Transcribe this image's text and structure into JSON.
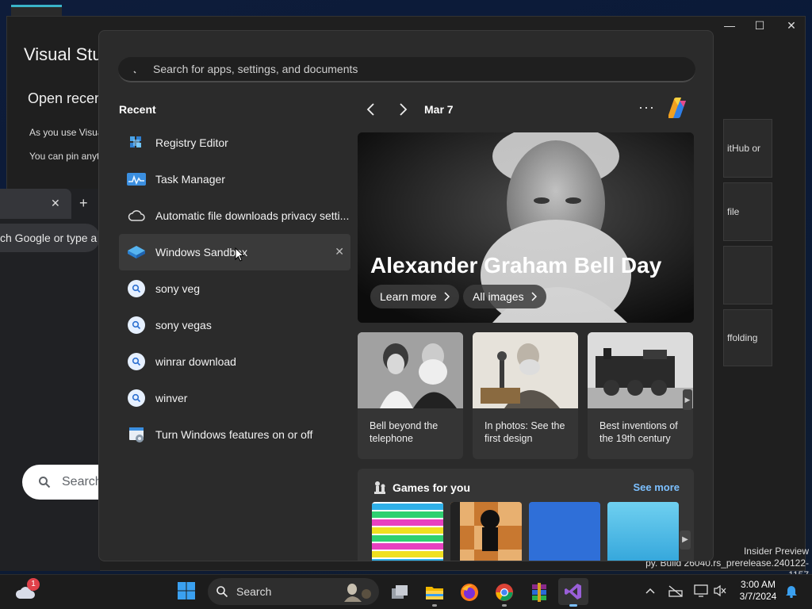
{
  "background": {
    "vs_title": "Visual Stu",
    "vs_open_recent": "Open recen",
    "vs_line1": "As you use Visua",
    "vs_line2": "You can pin anyt",
    "vs_cards": [
      "itHub or",
      "file",
      "",
      "ffolding"
    ],
    "chrome_address": "ch Google or type a",
    "chrome_search": "Search",
    "chrome_tab_close": "✕",
    "chrome_new_tab": "+",
    "build_line1": "Insider Preview",
    "build_line2": "py. Build 26040.rs_prerelease.240122-1157"
  },
  "start_menu": {
    "search_placeholder": "Search for apps, settings, and documents",
    "recent_heading": "Recent",
    "recent_items": [
      {
        "label": "Registry Editor",
        "icon": "registry-editor-icon"
      },
      {
        "label": "Task Manager",
        "icon": "task-manager-icon"
      },
      {
        "label": "Automatic file downloads privacy setti...",
        "icon": "cloud-icon"
      },
      {
        "label": "Windows Sandbox",
        "icon": "windows-sandbox-icon",
        "selected": true,
        "close": "✕"
      },
      {
        "label": "sony veg",
        "icon": "search-icon"
      },
      {
        "label": "sony vegas",
        "icon": "search-icon"
      },
      {
        "label": "winrar download",
        "icon": "search-icon"
      },
      {
        "label": "winver",
        "icon": "search-icon"
      },
      {
        "label": "Turn Windows features on or off",
        "icon": "windows-features-icon"
      }
    ],
    "date": "Mar 7",
    "more": "···",
    "hero": {
      "title": "Alexander Graham Bell Day",
      "learn_more": "Learn more",
      "all_images": "All images"
    },
    "cards": [
      {
        "title": "Bell beyond the telephone"
      },
      {
        "title": "In photos: See the first design"
      },
      {
        "title": "Best inventions of the 19th century"
      }
    ],
    "games": {
      "heading": "Games for you",
      "see_more": "See more",
      "tile_colors": [
        "#f0d020",
        "#c87830",
        "#2f6fd8",
        "#48b8e0"
      ]
    }
  },
  "taskbar": {
    "search_label": "Search",
    "notification_count": "1",
    "time": "3:00 AM",
    "date": "3/7/2024",
    "apps": [
      "start-icon",
      "task-view-icon",
      "file-explorer-icon",
      "firefox-icon",
      "chrome-icon",
      "winrar-icon",
      "visual-studio-icon"
    ]
  },
  "colors": {
    "accent": "#0078d4",
    "link": "#7cc0ff",
    "start_bg": "#2b2b2b"
  }
}
